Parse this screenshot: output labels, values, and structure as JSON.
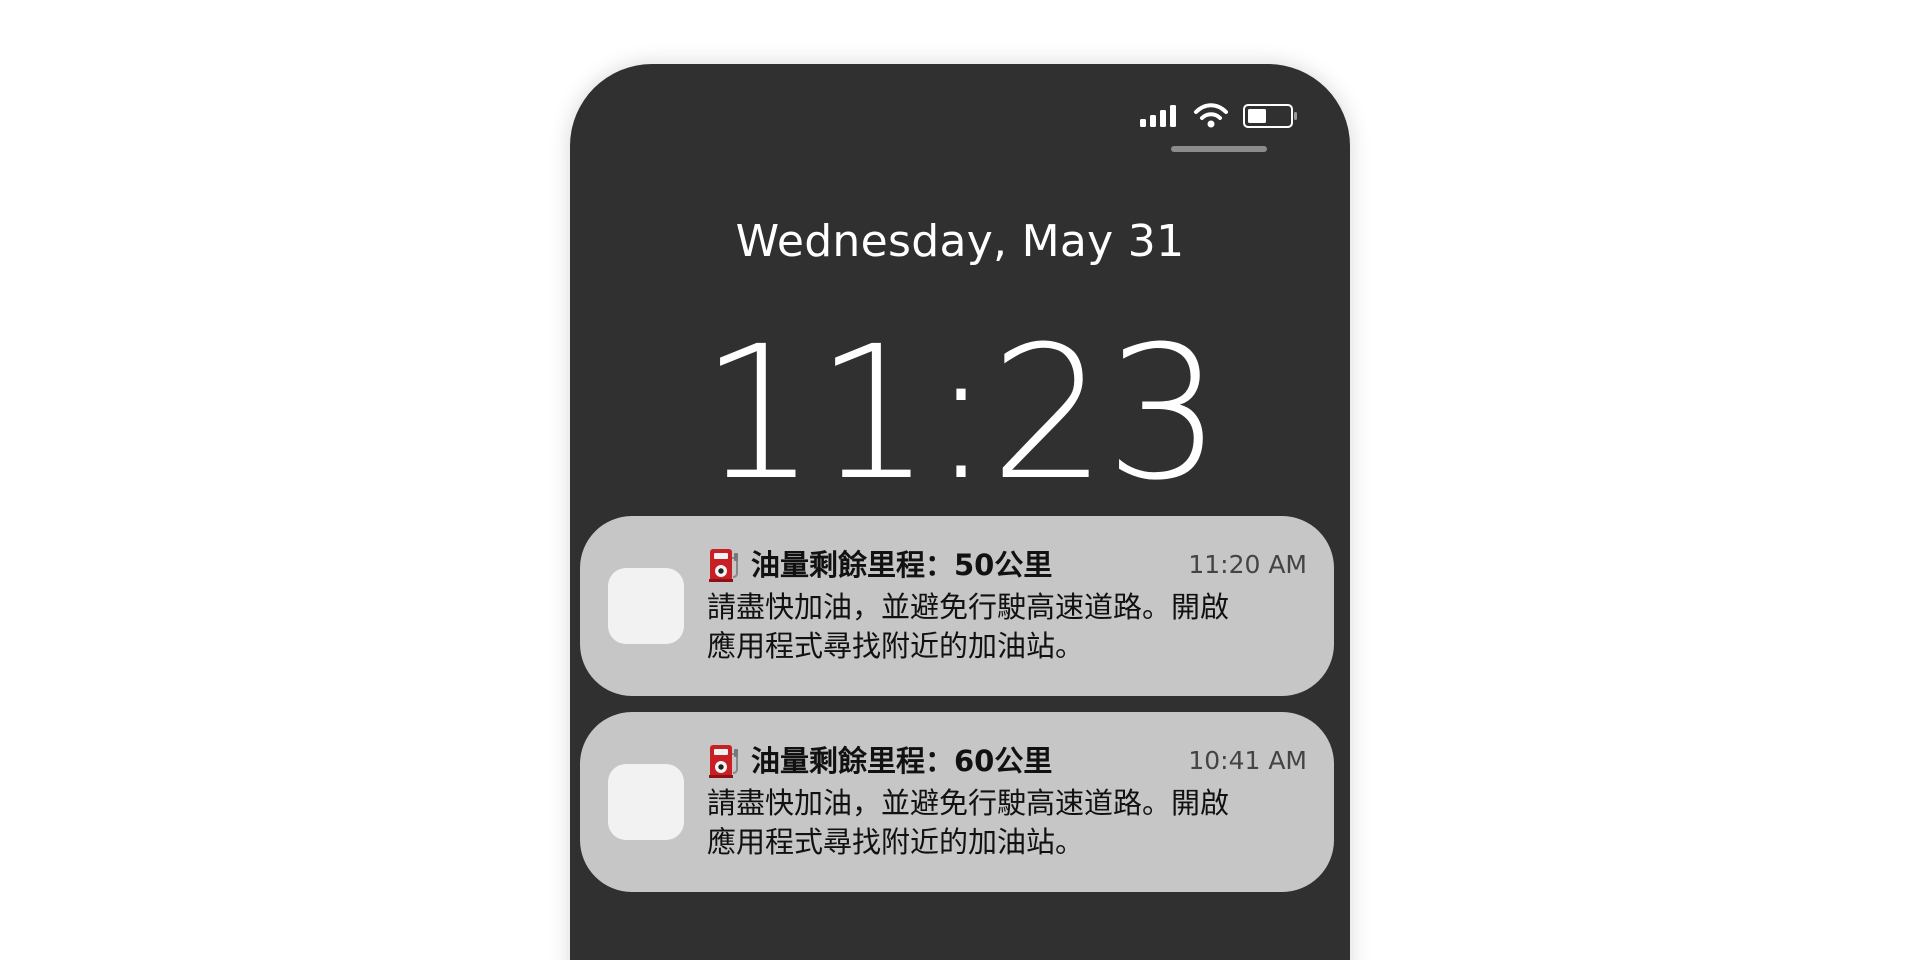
{
  "status_bar": {
    "signal_icon": "signal-bars-icon",
    "wifi_icon": "wifi-icon",
    "battery_icon": "battery-icon",
    "battery_level": 0.45
  },
  "lock_screen": {
    "date": "Wednesday, May 31",
    "time": "11:23"
  },
  "notifications": [
    {
      "icon": "fuel-pump-icon",
      "title": "油量剩餘里程：50公里",
      "time": "11:20 AM",
      "body_lines": [
        "請盡快加油，並避免行駛高速道路。開啟",
        "應用程式尋找附近的加油站。"
      ]
    },
    {
      "icon": "fuel-pump-icon",
      "title": "油量剩餘里程：60公里",
      "time": "10:41 AM",
      "body_lines": [
        "請盡快加油，並避免行駛高速道路。開啟",
        "應用程式尋找附近的加油站。"
      ]
    }
  ],
  "colors": {
    "phone_background": "#303030",
    "notification_background": "#c6c6c6",
    "fuel_pump": "#c71f24"
  }
}
